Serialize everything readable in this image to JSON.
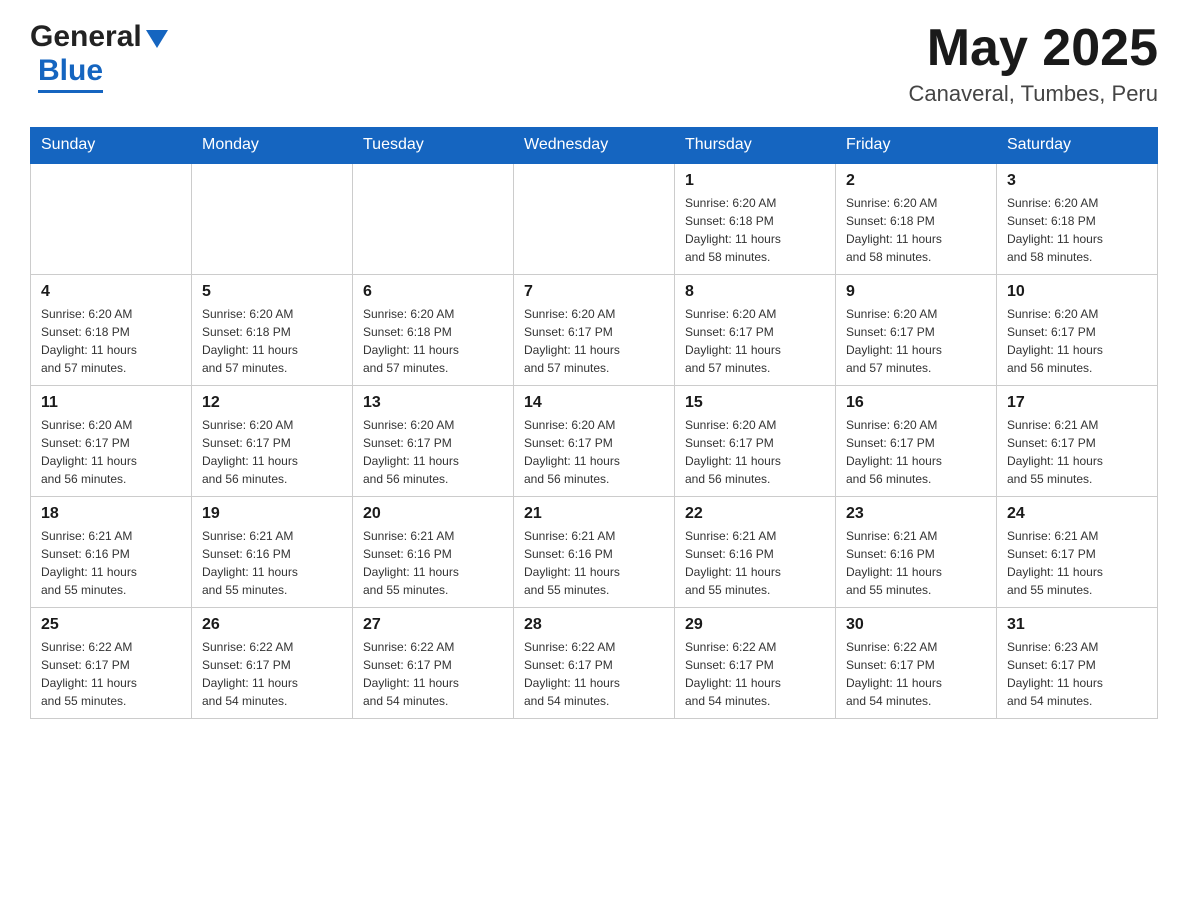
{
  "header": {
    "month_year": "May 2025",
    "location": "Canaveral, Tumbes, Peru",
    "logo_general": "General",
    "logo_blue": "Blue"
  },
  "weekdays": [
    "Sunday",
    "Monday",
    "Tuesday",
    "Wednesday",
    "Thursday",
    "Friday",
    "Saturday"
  ],
  "weeks": [
    [
      {
        "day": "",
        "info": ""
      },
      {
        "day": "",
        "info": ""
      },
      {
        "day": "",
        "info": ""
      },
      {
        "day": "",
        "info": ""
      },
      {
        "day": "1",
        "info": "Sunrise: 6:20 AM\nSunset: 6:18 PM\nDaylight: 11 hours\nand 58 minutes."
      },
      {
        "day": "2",
        "info": "Sunrise: 6:20 AM\nSunset: 6:18 PM\nDaylight: 11 hours\nand 58 minutes."
      },
      {
        "day": "3",
        "info": "Sunrise: 6:20 AM\nSunset: 6:18 PM\nDaylight: 11 hours\nand 58 minutes."
      }
    ],
    [
      {
        "day": "4",
        "info": "Sunrise: 6:20 AM\nSunset: 6:18 PM\nDaylight: 11 hours\nand 57 minutes."
      },
      {
        "day": "5",
        "info": "Sunrise: 6:20 AM\nSunset: 6:18 PM\nDaylight: 11 hours\nand 57 minutes."
      },
      {
        "day": "6",
        "info": "Sunrise: 6:20 AM\nSunset: 6:18 PM\nDaylight: 11 hours\nand 57 minutes."
      },
      {
        "day": "7",
        "info": "Sunrise: 6:20 AM\nSunset: 6:17 PM\nDaylight: 11 hours\nand 57 minutes."
      },
      {
        "day": "8",
        "info": "Sunrise: 6:20 AM\nSunset: 6:17 PM\nDaylight: 11 hours\nand 57 minutes."
      },
      {
        "day": "9",
        "info": "Sunrise: 6:20 AM\nSunset: 6:17 PM\nDaylight: 11 hours\nand 57 minutes."
      },
      {
        "day": "10",
        "info": "Sunrise: 6:20 AM\nSunset: 6:17 PM\nDaylight: 11 hours\nand 56 minutes."
      }
    ],
    [
      {
        "day": "11",
        "info": "Sunrise: 6:20 AM\nSunset: 6:17 PM\nDaylight: 11 hours\nand 56 minutes."
      },
      {
        "day": "12",
        "info": "Sunrise: 6:20 AM\nSunset: 6:17 PM\nDaylight: 11 hours\nand 56 minutes."
      },
      {
        "day": "13",
        "info": "Sunrise: 6:20 AM\nSunset: 6:17 PM\nDaylight: 11 hours\nand 56 minutes."
      },
      {
        "day": "14",
        "info": "Sunrise: 6:20 AM\nSunset: 6:17 PM\nDaylight: 11 hours\nand 56 minutes."
      },
      {
        "day": "15",
        "info": "Sunrise: 6:20 AM\nSunset: 6:17 PM\nDaylight: 11 hours\nand 56 minutes."
      },
      {
        "day": "16",
        "info": "Sunrise: 6:20 AM\nSunset: 6:17 PM\nDaylight: 11 hours\nand 56 minutes."
      },
      {
        "day": "17",
        "info": "Sunrise: 6:21 AM\nSunset: 6:17 PM\nDaylight: 11 hours\nand 55 minutes."
      }
    ],
    [
      {
        "day": "18",
        "info": "Sunrise: 6:21 AM\nSunset: 6:16 PM\nDaylight: 11 hours\nand 55 minutes."
      },
      {
        "day": "19",
        "info": "Sunrise: 6:21 AM\nSunset: 6:16 PM\nDaylight: 11 hours\nand 55 minutes."
      },
      {
        "day": "20",
        "info": "Sunrise: 6:21 AM\nSunset: 6:16 PM\nDaylight: 11 hours\nand 55 minutes."
      },
      {
        "day": "21",
        "info": "Sunrise: 6:21 AM\nSunset: 6:16 PM\nDaylight: 11 hours\nand 55 minutes."
      },
      {
        "day": "22",
        "info": "Sunrise: 6:21 AM\nSunset: 6:16 PM\nDaylight: 11 hours\nand 55 minutes."
      },
      {
        "day": "23",
        "info": "Sunrise: 6:21 AM\nSunset: 6:16 PM\nDaylight: 11 hours\nand 55 minutes."
      },
      {
        "day": "24",
        "info": "Sunrise: 6:21 AM\nSunset: 6:17 PM\nDaylight: 11 hours\nand 55 minutes."
      }
    ],
    [
      {
        "day": "25",
        "info": "Sunrise: 6:22 AM\nSunset: 6:17 PM\nDaylight: 11 hours\nand 55 minutes."
      },
      {
        "day": "26",
        "info": "Sunrise: 6:22 AM\nSunset: 6:17 PM\nDaylight: 11 hours\nand 54 minutes."
      },
      {
        "day": "27",
        "info": "Sunrise: 6:22 AM\nSunset: 6:17 PM\nDaylight: 11 hours\nand 54 minutes."
      },
      {
        "day": "28",
        "info": "Sunrise: 6:22 AM\nSunset: 6:17 PM\nDaylight: 11 hours\nand 54 minutes."
      },
      {
        "day": "29",
        "info": "Sunrise: 6:22 AM\nSunset: 6:17 PM\nDaylight: 11 hours\nand 54 minutes."
      },
      {
        "day": "30",
        "info": "Sunrise: 6:22 AM\nSunset: 6:17 PM\nDaylight: 11 hours\nand 54 minutes."
      },
      {
        "day": "31",
        "info": "Sunrise: 6:23 AM\nSunset: 6:17 PM\nDaylight: 11 hours\nand 54 minutes."
      }
    ]
  ]
}
